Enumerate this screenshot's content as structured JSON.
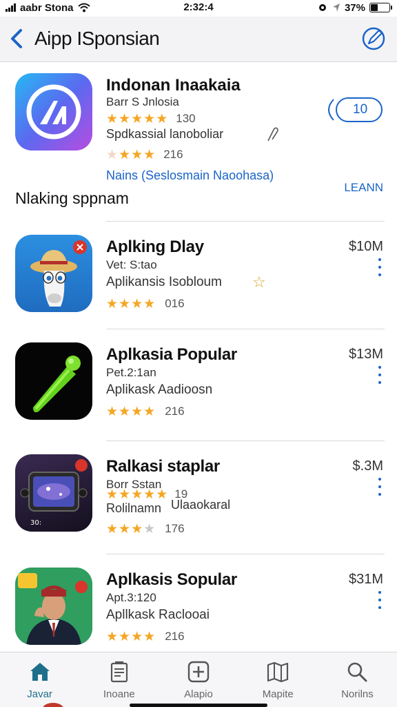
{
  "status_bar": {
    "carrier": "aabr Stona",
    "time": "2:32:4",
    "battery": "37%",
    "battery_fraction": 0.37
  },
  "nav": {
    "title": "Aipp ISponsian"
  },
  "featured": {
    "title": "Indonan  Inaakaia",
    "subtitle": "Barr S Jnlosia",
    "rating1_count": "130",
    "rating1_stars": 5,
    "description": "Spdkassial lanoboliar",
    "rating2_count": "216",
    "rating2_stars": 4,
    "link": "Nains (Seslosmain Naoohasa)",
    "badge": "10",
    "learn": "LEANN"
  },
  "section_title": "Nlaking sppnam",
  "apps": [
    {
      "title": "Aplking Dlay",
      "subtitle": "Vet: S:tao",
      "description": "Aplikansis  Isobloum",
      "rating_count": "016",
      "stars": 4,
      "price": "$10M"
    },
    {
      "title": "Aplkasia Popular",
      "subtitle": "Pet.2:1an",
      "description": "Aplikask  Aadioosn",
      "rating_count": "216",
      "stars": 4,
      "price": "$13M"
    },
    {
      "title": "Ralkasi staplar",
      "subtitle": "Borr Sstan",
      "description": "Rolilnamn",
      "extra_count": "19",
      "extra_text": "Ulaaokaral",
      "rating_count": "176",
      "stars": 3,
      "price": "$.3M"
    },
    {
      "title": "Aplkasis Sopular",
      "subtitle": "Apt.3:120",
      "description": "Apllkask  Raclooai",
      "rating_count": "216",
      "stars": 4,
      "price": "$31M"
    }
  ],
  "tabs": [
    {
      "label": "Javar",
      "icon": "home-icon",
      "active": true
    },
    {
      "label": "Inoane",
      "icon": "document-icon",
      "active": false
    },
    {
      "label": "Alapio",
      "icon": "plus-square-icon",
      "active": false
    },
    {
      "label": "Mapite",
      "icon": "map-icon",
      "active": false
    },
    {
      "label": "Norilns",
      "icon": "search-icon",
      "active": false
    }
  ],
  "colors": {
    "accent": "#1a64c8",
    "star": "#f5a623",
    "active_tab": "#1f6f8b"
  }
}
